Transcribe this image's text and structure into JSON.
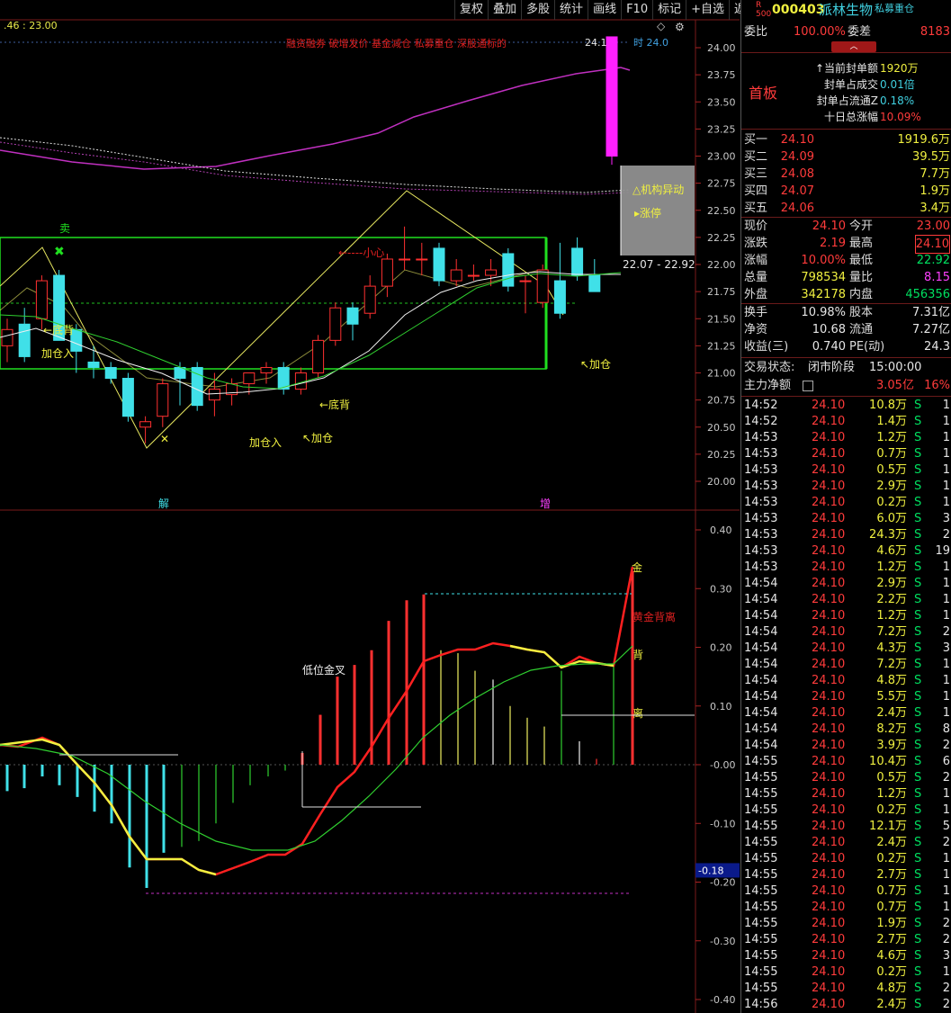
{
  "toolbar": [
    "复权",
    "叠加",
    "多股",
    "统计",
    "画线",
    "F10",
    "标记",
    "+自选",
    "返回"
  ],
  "chart_header": {
    "readout": ".46 : 23.00",
    "hint": "融资融券 破增发价 基金减仓 私募重仓 深股通标的",
    "top_price": "24.10",
    "top_right": "时 24.0"
  },
  "price_axis": [
    "24.00",
    "23.75",
    "23.50",
    "23.25",
    "23.00",
    "22.75",
    "22.50",
    "22.25",
    "22.00",
    "21.75",
    "21.50",
    "21.25",
    "21.00",
    "20.75",
    "20.50",
    "20.25",
    "20.00"
  ],
  "ind_axis": [
    "0.40",
    "0.30",
    "0.20",
    "0.10",
    "-0.00",
    "-0.10",
    "-0.20",
    "-0.30",
    "-0.40"
  ],
  "ind_marker": "-0.18",
  "annotations": {
    "sell": "卖",
    "dibei1": "←底背",
    "jiacang1": "加仓入",
    "x_mark": "✕",
    "dibei2": "←底背",
    "jiacang2": "加仓入",
    "jiacang3": "↖加仓",
    "xiaoxin": "←----小心",
    "jiacang4": "↖加仓",
    "jie": "解",
    "zeng": "增",
    "jigou": "△机构异动",
    "zhangting": "▸涨停",
    "range": "22.07 - 22.92",
    "jin": "金",
    "jinbeili": "黄金背离",
    "bei": "背",
    "li": "离",
    "diwei": "低位金叉"
  },
  "stock": {
    "badge_r": "R",
    "badge_num": "500",
    "code": "000403",
    "name": "派林生物",
    "tag": "私募重仓"
  },
  "quote": {
    "weibi_label": "委比",
    "weibi": "100.00%",
    "weicha_label": "委差",
    "weicha": "8183",
    "board": "首板",
    "seal": [
      {
        "label": "↑当前封单额",
        "value": "1920万"
      },
      {
        "label": "封单占成交",
        "value": "0.01倍"
      },
      {
        "label": "封单占流通Z",
        "value": "0.18%"
      },
      {
        "label": "十日总涨幅",
        "value": "10.09%"
      }
    ],
    "bids": [
      {
        "label": "买一",
        "price": "24.10",
        "vol": "1919.6万"
      },
      {
        "label": "买二",
        "price": "24.09",
        "vol": "39.5万"
      },
      {
        "label": "买三",
        "price": "24.08",
        "vol": "7.7万"
      },
      {
        "label": "买四",
        "price": "24.07",
        "vol": "1.9万"
      },
      {
        "label": "买五",
        "price": "24.06",
        "vol": "3.4万"
      }
    ],
    "stats": [
      {
        "l1": "现价",
        "v1": "24.10",
        "l2": "今开",
        "v2": "23.00"
      },
      {
        "l1": "涨跌",
        "v1": "2.19",
        "l2": "最高",
        "v2": "24.10"
      },
      {
        "l1": "涨幅",
        "v1": "10.00%",
        "l2": "最低",
        "v2": "22.92"
      },
      {
        "l1": "总量",
        "v1": "798534",
        "l2": "量比",
        "v2": "8.15"
      },
      {
        "l1": "外盘",
        "v1": "342178",
        "l2": "内盘",
        "v2": "456356"
      }
    ],
    "stats2": [
      {
        "l1": "换手",
        "v1": "10.98%",
        "l2": "股本",
        "v2": "7.31亿"
      },
      {
        "l1": "净资",
        "v1": "10.68",
        "l2": "流通",
        "v2": "7.27亿"
      },
      {
        "l1": "收益(三)",
        "v1": "0.740",
        "l2": "PE(动)",
        "v2": "24.3"
      }
    ],
    "status_label": "交易状态:",
    "status": "闭市阶段",
    "status_time": "15:00:00",
    "flow_label": "主力净额",
    "flow": "3.05亿",
    "flow_pct": "16%"
  },
  "trades": [
    {
      "t": "14:52",
      "p": "24.10",
      "v": "10.8万",
      "s": "S",
      "n": "1"
    },
    {
      "t": "14:52",
      "p": "24.10",
      "v": "1.4万",
      "s": "S",
      "n": "1"
    },
    {
      "t": "14:53",
      "p": "24.10",
      "v": "1.2万",
      "s": "S",
      "n": "1"
    },
    {
      "t": "14:53",
      "p": "24.10",
      "v": "0.7万",
      "s": "S",
      "n": "1"
    },
    {
      "t": "14:53",
      "p": "24.10",
      "v": "0.5万",
      "s": "S",
      "n": "1"
    },
    {
      "t": "14:53",
      "p": "24.10",
      "v": "2.9万",
      "s": "S",
      "n": "1"
    },
    {
      "t": "14:53",
      "p": "24.10",
      "v": "0.2万",
      "s": "S",
      "n": "1"
    },
    {
      "t": "14:53",
      "p": "24.10",
      "v": "6.0万",
      "s": "S",
      "n": "3"
    },
    {
      "t": "14:53",
      "p": "24.10",
      "v": "24.3万",
      "s": "S",
      "n": "2"
    },
    {
      "t": "14:53",
      "p": "24.10",
      "v": "4.6万",
      "s": "S",
      "n": "19"
    },
    {
      "t": "14:53",
      "p": "24.10",
      "v": "1.2万",
      "s": "S",
      "n": "1"
    },
    {
      "t": "14:54",
      "p": "24.10",
      "v": "2.9万",
      "s": "S",
      "n": "1"
    },
    {
      "t": "14:54",
      "p": "24.10",
      "v": "2.2万",
      "s": "S",
      "n": "1"
    },
    {
      "t": "14:54",
      "p": "24.10",
      "v": "1.2万",
      "s": "S",
      "n": "1"
    },
    {
      "t": "14:54",
      "p": "24.10",
      "v": "7.2万",
      "s": "S",
      "n": "2"
    },
    {
      "t": "14:54",
      "p": "24.10",
      "v": "4.3万",
      "s": "S",
      "n": "3"
    },
    {
      "t": "14:54",
      "p": "24.10",
      "v": "7.2万",
      "s": "S",
      "n": "1"
    },
    {
      "t": "14:54",
      "p": "24.10",
      "v": "4.8万",
      "s": "S",
      "n": "1"
    },
    {
      "t": "14:54",
      "p": "24.10",
      "v": "5.5万",
      "s": "S",
      "n": "1"
    },
    {
      "t": "14:54",
      "p": "24.10",
      "v": "2.4万",
      "s": "S",
      "n": "1"
    },
    {
      "t": "14:54",
      "p": "24.10",
      "v": "8.2万",
      "s": "S",
      "n": "8"
    },
    {
      "t": "14:54",
      "p": "24.10",
      "v": "3.9万",
      "s": "S",
      "n": "2"
    },
    {
      "t": "14:55",
      "p": "24.10",
      "v": "10.4万",
      "s": "S",
      "n": "6"
    },
    {
      "t": "14:55",
      "p": "24.10",
      "v": "0.5万",
      "s": "S",
      "n": "2"
    },
    {
      "t": "14:55",
      "p": "24.10",
      "v": "1.2万",
      "s": "S",
      "n": "1"
    },
    {
      "t": "14:55",
      "p": "24.10",
      "v": "0.2万",
      "s": "S",
      "n": "1"
    },
    {
      "t": "14:55",
      "p": "24.10",
      "v": "12.1万",
      "s": "S",
      "n": "5"
    },
    {
      "t": "14:55",
      "p": "24.10",
      "v": "2.4万",
      "s": "S",
      "n": "2"
    },
    {
      "t": "14:55",
      "p": "24.10",
      "v": "0.2万",
      "s": "S",
      "n": "1"
    },
    {
      "t": "14:55",
      "p": "24.10",
      "v": "2.7万",
      "s": "S",
      "n": "1"
    },
    {
      "t": "14:55",
      "p": "24.10",
      "v": "0.7万",
      "s": "S",
      "n": "1"
    },
    {
      "t": "14:55",
      "p": "24.10",
      "v": "0.7万",
      "s": "S",
      "n": "1"
    },
    {
      "t": "14:55",
      "p": "24.10",
      "v": "1.9万",
      "s": "S",
      "n": "2"
    },
    {
      "t": "14:55",
      "p": "24.10",
      "v": "2.7万",
      "s": "S",
      "n": "2"
    },
    {
      "t": "14:55",
      "p": "24.10",
      "v": "4.6万",
      "s": "S",
      "n": "3"
    },
    {
      "t": "14:55",
      "p": "24.10",
      "v": "0.2万",
      "s": "S",
      "n": "1"
    },
    {
      "t": "14:55",
      "p": "24.10",
      "v": "4.8万",
      "s": "S",
      "n": "2"
    },
    {
      "t": "14:56",
      "p": "24.10",
      "v": "2.4万",
      "s": "S",
      "n": "2"
    }
  ],
  "chart_data": {
    "type": "candlestick",
    "price_range": [
      20.0,
      24.0
    ],
    "candles": [
      {
        "o": 21.25,
        "h": 21.5,
        "l": 21.1,
        "c": 21.4
      },
      {
        "o": 21.45,
        "h": 21.6,
        "l": 21.1,
        "c": 21.15
      },
      {
        "o": 21.5,
        "h": 21.9,
        "l": 21.4,
        "c": 21.85
      },
      {
        "o": 21.9,
        "h": 21.95,
        "l": 21.3,
        "c": 21.3
      },
      {
        "o": 21.4,
        "h": 21.45,
        "l": 21.0,
        "c": 21.2
      },
      {
        "o": 21.1,
        "h": 21.25,
        "l": 20.95,
        "c": 21.05
      },
      {
        "o": 21.05,
        "h": 21.1,
        "l": 20.9,
        "c": 20.95
      },
      {
        "o": 20.95,
        "h": 21.0,
        "l": 20.55,
        "c": 20.6
      },
      {
        "o": 20.5,
        "h": 20.6,
        "l": 20.35,
        "c": 20.55
      },
      {
        "o": 20.6,
        "h": 20.95,
        "l": 20.5,
        "c": 20.9
      },
      {
        "o": 21.05,
        "h": 21.1,
        "l": 20.7,
        "c": 20.95
      },
      {
        "o": 21.05,
        "h": 21.1,
        "l": 20.65,
        "c": 20.7
      },
      {
        "o": 20.75,
        "h": 21.0,
        "l": 20.6,
        "c": 20.85
      },
      {
        "o": 20.8,
        "h": 20.95,
        "l": 20.7,
        "c": 20.9
      },
      {
        "o": 20.9,
        "h": 21.0,
        "l": 20.8,
        "c": 21.0
      },
      {
        "o": 21.0,
        "h": 21.1,
        "l": 20.9,
        "c": 21.05
      },
      {
        "o": 21.05,
        "h": 21.1,
        "l": 20.8,
        "c": 20.85
      },
      {
        "o": 20.85,
        "h": 21.05,
        "l": 20.8,
        "c": 21.0
      },
      {
        "o": 21.0,
        "h": 21.35,
        "l": 20.95,
        "c": 21.3
      },
      {
        "o": 21.3,
        "h": 21.65,
        "l": 21.25,
        "c": 21.6
      },
      {
        "o": 21.6,
        "h": 21.65,
        "l": 21.3,
        "c": 21.45
      },
      {
        "o": 21.55,
        "h": 21.9,
        "l": 21.5,
        "c": 21.8
      },
      {
        "o": 21.8,
        "h": 22.1,
        "l": 21.7,
        "c": 22.05
      },
      {
        "o": 22.05,
        "h": 22.35,
        "l": 21.95,
        "c": 22.05
      },
      {
        "o": 22.05,
        "h": 22.2,
        "l": 21.9,
        "c": 22.05
      },
      {
        "o": 22.15,
        "h": 22.2,
        "l": 21.8,
        "c": 21.85
      },
      {
        "o": 21.85,
        "h": 22.05,
        "l": 21.8,
        "c": 21.95
      },
      {
        "o": 21.9,
        "h": 22.0,
        "l": 21.85,
        "c": 21.9
      },
      {
        "o": 21.9,
        "h": 22.05,
        "l": 21.8,
        "c": 21.95
      },
      {
        "o": 22.1,
        "h": 22.15,
        "l": 21.75,
        "c": 21.8
      },
      {
        "o": 21.85,
        "h": 21.9,
        "l": 21.55,
        "c": 21.85
      },
      {
        "o": 21.65,
        "h": 22.0,
        "l": 21.6,
        "c": 21.95
      },
      {
        "o": 21.85,
        "h": 22.2,
        "l": 21.5,
        "c": 21.55
      },
      {
        "o": 22.15,
        "h": 22.25,
        "l": 21.85,
        "c": 21.9
      },
      {
        "o": 21.9,
        "h": 22.05,
        "l": 21.75,
        "c": 21.75
      },
      {
        "o": 23.0,
        "h": 24.1,
        "l": 22.92,
        "c": 24.1
      }
    ],
    "macd": [
      -0.02,
      -0.03,
      -0.04,
      -0.015,
      -0.035,
      -0.06,
      -0.08,
      -0.1,
      -0.15,
      -0.12,
      -0.11,
      -0.1,
      -0.07,
      -0.05,
      -0.04,
      -0.02,
      -0.01,
      -0.02,
      -0.15,
      0.05,
      0.09,
      0.15,
      0.1,
      0.12,
      0.17,
      0.2,
      0.27,
      0.29,
      0.3,
      0.2,
      0.15,
      0.12,
      0.1,
      0.07,
      0.06,
      0.04,
      0.02,
      0.0,
      0.02,
      0.01,
      0.0,
      0.3
    ]
  }
}
